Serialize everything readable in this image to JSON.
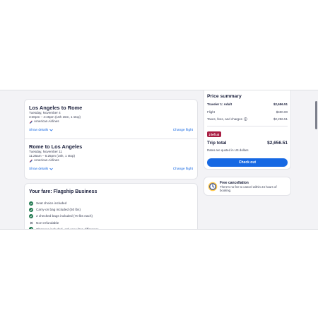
{
  "flights": {
    "legs": [
      {
        "title": "Los Angeles to Rome",
        "date": "Tuesday, November 4",
        "time": "3:30pm – 4:45pm (16h 15m, 1 stop)",
        "airline": "American Airlines",
        "show_details": "Show details",
        "change_flight": "Change flight"
      },
      {
        "title": "Rome to Los Angeles",
        "date": "Tuesday, November 11",
        "time": "11:25am – 6:25pm (16h, 1 stop)",
        "airline": "American Airlines",
        "show_details": "Show details",
        "change_flight": "Change flight"
      }
    ]
  },
  "fare": {
    "title": "Your fare: Flagship Business",
    "items": [
      {
        "text": "Seat choice included",
        "status": "included"
      },
      {
        "text": "Carry-on bag included (50 lbs)",
        "status": "included"
      },
      {
        "text": "2 checked bags included (70 lbs each)",
        "status": "included"
      },
      {
        "text": "Non-refundable",
        "status": "not-included"
      },
      {
        "text": "Changes included, only pay fare difference",
        "status": "included"
      }
    ]
  },
  "price_summary": {
    "title": "Price summary",
    "traveler_label": "Traveler 1: Adult",
    "traveler_value": "$2,656.51",
    "flight_label": "Flight",
    "flight_value": "$400.00",
    "taxes_label": "Taxes, fees, and charges",
    "taxes_value": "$2,256.51",
    "badge": "2 left at",
    "trip_total_label": "Trip total",
    "trip_total_value": "$2,656.51",
    "rates_note": "Rates are quoted in US dollars",
    "checkout_label": "Check out"
  },
  "cancellation": {
    "title": "Free cancellation",
    "text": "There's no fee to cancel within 24 hours of booking."
  },
  "colors": {
    "accent": "#1668e3",
    "success": "#227950",
    "badge": "#a91e43"
  }
}
